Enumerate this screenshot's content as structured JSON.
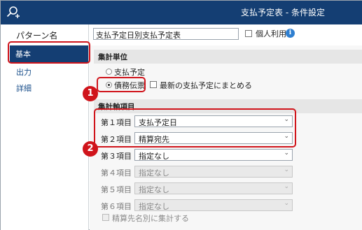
{
  "title": "支払予定表 - 条件設定",
  "sidebar": {
    "pattern_label": "パターン名",
    "items": [
      {
        "label": "基本",
        "selected": true
      },
      {
        "label": "出力",
        "selected": false
      },
      {
        "label": "詳細",
        "selected": false
      }
    ]
  },
  "pattern": {
    "value": "支払予定日別支払予定表",
    "personal_use_label": "個人利用",
    "personal_use_checked": false
  },
  "unit_section": {
    "title": "集計単位",
    "options": [
      {
        "label": "支払予定",
        "checked": false
      },
      {
        "label": "債務伝票",
        "checked": true
      }
    ],
    "latest_label": "最新の支払予定にまとめる",
    "latest_checked": false
  },
  "axis_section": {
    "title": "集計軸項目",
    "rows": [
      {
        "label": "第１項目",
        "value": "支払予定日",
        "enabled": true
      },
      {
        "label": "第２項目",
        "value": "精算宛先",
        "enabled": true
      },
      {
        "label": "第３項目",
        "value": "指定なし",
        "enabled": true
      },
      {
        "label": "第４項目",
        "value": "指定なし",
        "enabled": false
      },
      {
        "label": "第５項目",
        "value": "指定なし",
        "enabled": false
      },
      {
        "label": "第６項目",
        "value": "指定なし",
        "enabled": false
      }
    ],
    "summary_label": "精算先名別に集計する",
    "summary_checked": false
  },
  "annotations": {
    "badge_1": "1",
    "badge_2": "2",
    "color": "#d0141b"
  },
  "colors": {
    "titlebar": "#143e73",
    "selected_item": "#143e73",
    "info_icon": "#2f7fd0"
  }
}
